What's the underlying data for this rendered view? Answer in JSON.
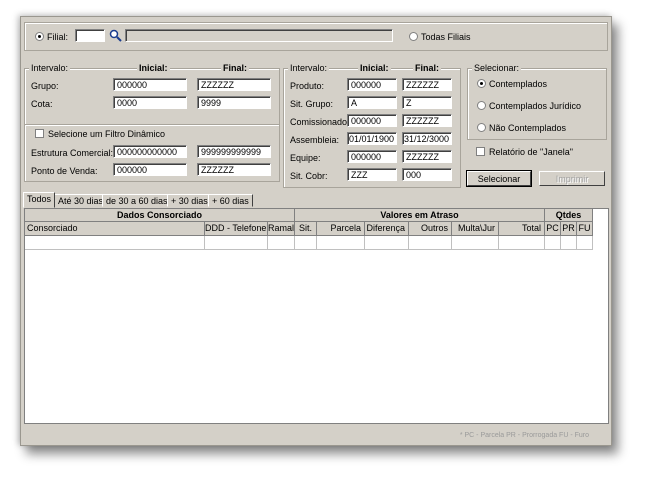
{
  "filter_bar": {
    "filial_label": "Filial:",
    "filial_code": "",
    "filial_name": "",
    "todas_filiais": "Todas Filiais"
  },
  "left_group": {
    "intervalo": "Intervalo:",
    "inicial": "Inicial:",
    "final": "Final:",
    "rows": [
      {
        "label": "Grupo:",
        "inicial": "000000",
        "final": "ZZZZZZ"
      },
      {
        "label": "Cota:",
        "inicial": "0000",
        "final": "9999"
      }
    ],
    "filtro_dinamico": "Selecione um Filtro Dinâmico",
    "rows2": [
      {
        "label": "Estrutura Comercial:",
        "inicial": "000000000000",
        "final": "999999999999"
      },
      {
        "label": "Ponto de Venda:",
        "inicial": "000000",
        "final": "ZZZZZZ"
      }
    ]
  },
  "middle_group": {
    "intervalo": "Intervalo:",
    "inicial": "Inicial:",
    "final": "Final:",
    "rows": [
      {
        "label": "Produto:",
        "inicial": "000000",
        "final": "ZZZZZZ"
      },
      {
        "label": "Sit. Grupo:",
        "inicial": "A",
        "final": "Z"
      },
      {
        "label": "Comissionado:",
        "inicial": "000000",
        "final": "ZZZZZZ"
      },
      {
        "label": "Assembleia:",
        "inicial": "01/01/1900",
        "final": "31/12/3000"
      },
      {
        "label": "Equipe:",
        "inicial": "000000",
        "final": "ZZZZZZ"
      },
      {
        "label": "Sit. Cobr:",
        "inicial": "ZZZ",
        "final": "000"
      }
    ]
  },
  "selecionar_group": {
    "title": "Selecionar:",
    "options": [
      "Contemplados",
      "Contemplados Jurídico",
      "Não Contemplados"
    ],
    "selected": 0
  },
  "relatorio_janela": "Relatório de \"Janela\"",
  "buttons": {
    "selecionar": "Selecionar",
    "imprimir": "Imprimir"
  },
  "tabs": [
    "Todos",
    "Até 30 dias",
    "de 30 a 60 dias",
    "+ 30 dias",
    "+ 60 dias"
  ],
  "table": {
    "groups": [
      "Dados Consorciado",
      "Valores em Atraso",
      "Qtdes"
    ],
    "columns": [
      "Consorciado",
      "DDD - Telefone",
      "Ramal",
      "Sit.",
      "Parcela",
      "Diferença",
      "Outros",
      "Multa\\Jur",
      "Total",
      "PC",
      "PR",
      "FU"
    ]
  },
  "footer": "* PC - Parcela   PR - Prorrogada   FU - Furo"
}
